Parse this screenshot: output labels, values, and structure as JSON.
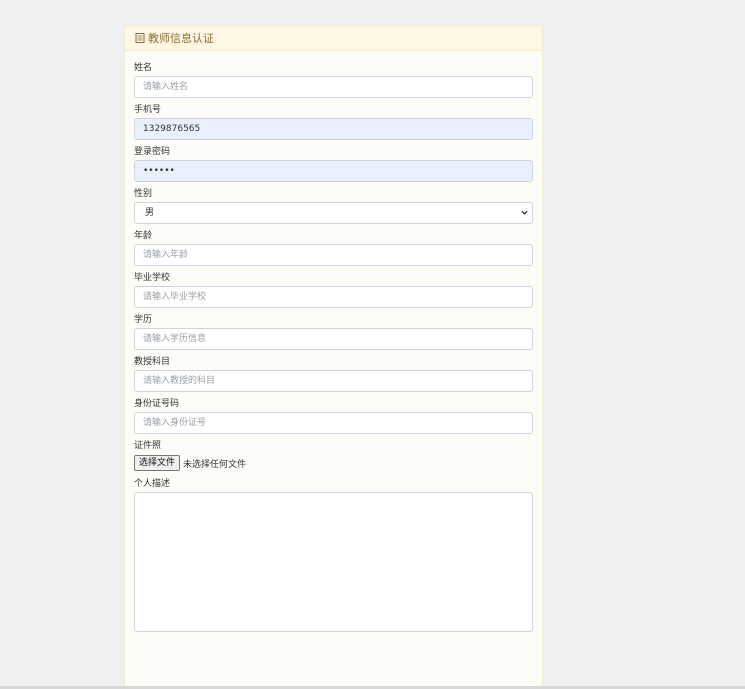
{
  "panel": {
    "title": "教师信息认证"
  },
  "form": {
    "name": {
      "label": "姓名",
      "placeholder": "请输入姓名",
      "value": ""
    },
    "phone": {
      "label": "手机号",
      "placeholder": "",
      "value": "1329876565"
    },
    "password": {
      "label": "登录密码",
      "placeholder": "",
      "value": "••••••"
    },
    "gender": {
      "label": "性别",
      "selected": "男"
    },
    "age": {
      "label": "年龄",
      "placeholder": "请输入年龄",
      "value": ""
    },
    "school": {
      "label": "毕业学校",
      "placeholder": "请输入毕业学校",
      "value": ""
    },
    "education": {
      "label": "学历",
      "placeholder": "请输入学历信息",
      "value": ""
    },
    "subject": {
      "label": "教授科目",
      "placeholder": "请输入教授的科目",
      "value": ""
    },
    "id_number": {
      "label": "身份证号码",
      "placeholder": "请输入身份证号",
      "value": ""
    },
    "photo": {
      "label": "证件照",
      "button_label": "选择文件",
      "status": "未选择任何文件"
    },
    "description": {
      "label": "个人描述",
      "value": ""
    }
  },
  "colors": {
    "header_bg": "#fcf8e3",
    "header_text": "#8a6d3b",
    "autofill_bg": "#e8f0fe"
  }
}
